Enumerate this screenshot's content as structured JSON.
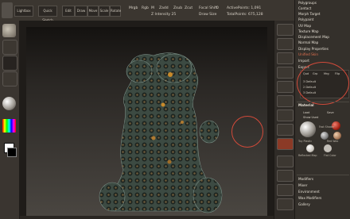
{
  "toolbar": {
    "buttons": [
      "Lightbox",
      "Quick Sketch",
      "Edit",
      "Draw",
      "Move",
      "Scale",
      "Rotate"
    ],
    "labels": [
      "Mrgb",
      "Rgb",
      "M",
      "Zadd",
      "Zsub",
      "Zcut",
      "Focal Shift",
      "Draw Size"
    ],
    "values": [
      "0",
      "Z Intensity 25",
      "ActivePoints: 1,091",
      "TotalPoints: 675,128"
    ]
  },
  "colors": {
    "accent": "#d24a3a",
    "panel_bg": "#34302b",
    "canvas_top": "#141210",
    "canvas_bottom": "#4a4641"
  },
  "right_menu": {
    "items": [
      "Polygroups",
      "Contact",
      "Morph Target",
      "Polypaint",
      "UV Map",
      "Texture Map",
      "Displacement Map",
      "Normal Map",
      "Display Properties",
      "Unified Skin",
      "Import",
      "Export"
    ],
    "export_options": [
      "Qud",
      "Grp",
      "Mrg",
      "Flip",
      "3 Default",
      "2 Default",
      "3 Default"
    ]
  },
  "material": {
    "title": "Material",
    "load": "Load",
    "save": "Save",
    "show_used": "Show Used",
    "items": [
      "Fast Shader",
      "Toy Plastic",
      "Red Wax",
      "Reflected Map",
      "Flat Color"
    ],
    "bottom_items": [
      "Modifiers",
      "Mixer",
      "Environment",
      "Wax Modifiers",
      "Gallery"
    ]
  },
  "icons": [
    "cursor-circle-icon",
    "gear-icon",
    "move-icon",
    "scale-icon",
    "rotate-icon",
    "frame-icon",
    "brush-icon",
    "material-sphere-icon",
    "color-picker-icon"
  ]
}
